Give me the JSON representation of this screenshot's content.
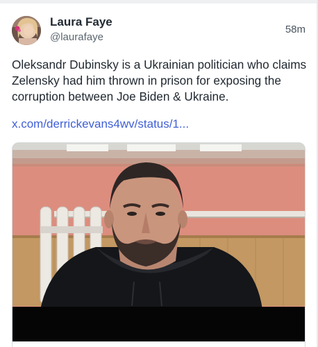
{
  "post": {
    "author": {
      "display_name": "Laura Faye",
      "handle": "@laurafaye",
      "avatar": "avatar-photo"
    },
    "time": "58m",
    "text": "Oleksandr Dubinsky is a Ukrainian politician who claims Zelensky had him thrown in prison for exposing the corruption between Joe Biden & Ukraine.",
    "link": "x.com/derrickevans4wv/status/1...",
    "media": {
      "kind": "video-thumbnail"
    }
  },
  "colors": {
    "link": "#3f5fd6",
    "wall": "#dd8f80",
    "panel": "#c49a62"
  }
}
